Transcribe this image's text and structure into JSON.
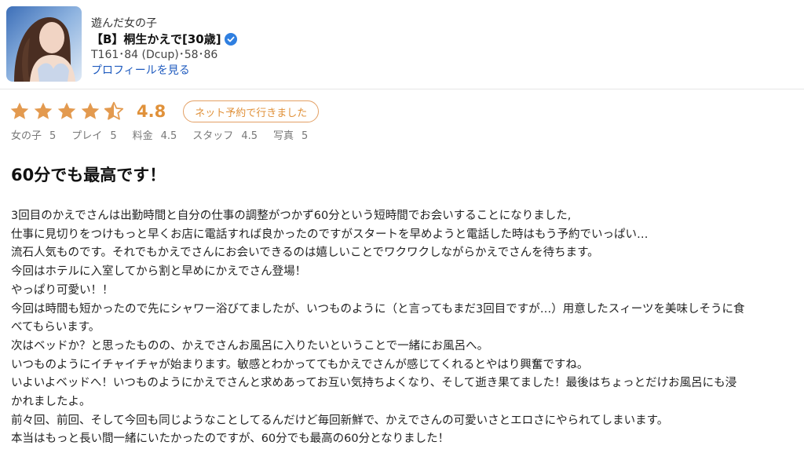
{
  "profile": {
    "label": "遊んだ女の子",
    "name": "【B】桐生かえで[30歳]",
    "specs": "T161･84 (Dcup)･58･86",
    "profile_link": "プロフィールを見る"
  },
  "rating": {
    "stars_value": 4.5,
    "score": "4.8",
    "badge": "ネット予約で行きました",
    "accent_color": "#e39a4f"
  },
  "subscores": [
    {
      "label": "女の子",
      "value": "5"
    },
    {
      "label": "プレイ",
      "value": "5"
    },
    {
      "label": "料金",
      "value": "4.5"
    },
    {
      "label": "スタッフ",
      "value": "4.5"
    },
    {
      "label": "写真",
      "value": "5"
    }
  ],
  "review": {
    "title": "60分でも最高です！",
    "lines": [
      "3回目のかえでさんは出勤時間と自分の仕事の調整がつかず60分という短時間でお会いすることになりました,",
      "仕事に見切りをつけもっと早くお店に電話すれば良かったのですがスタートを早めようと電話した時はもう予約でいっぱい…",
      "流石人気ものです。それでもかえでさんにお会いできるのは嬉しいことでワクワクしながらかえでさんを待ちます。",
      "今回はホテルに入室してから割と早めにかえでさん登場！",
      "やっぱり可愛い！！",
      "今回は時間も短かったので先にシャワー浴びてましたが、いつものように（と言ってもまだ3回目ですが…）用意したスィーツを美味しそうに食",
      "べてもらいます。",
      "次はベッドか？と思ったものの、かえでさんお風呂に入りたいということで一緒にお風呂へ。",
      "いつものようにイチャイチャが始まります。敏感とわかっててもかえでさんが感じてくれるとやはり興奮ですね。",
      "いよいよベッドへ！いつものようにかえでさんと求めあってお互い気持ちよくなり、そして逝き果てました！最後はちょっとだけお風呂にも浸",
      "かれましたよ。",
      "前々回、前回、そして今回も同じようなことしてるんだけど毎回新鮮で、かえでさんの可愛いさとエロさにやられてしまいます。",
      "本当はもっと長い間一緒にいたかったのですが、60分でも最高の60分となりました！"
    ]
  }
}
